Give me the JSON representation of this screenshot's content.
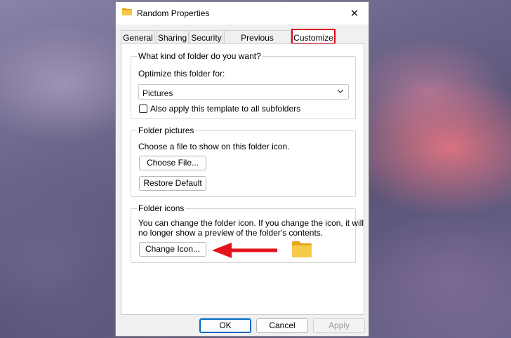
{
  "window": {
    "title": "Random Properties",
    "close_glyph": "✕"
  },
  "tabs": [
    {
      "label": "General"
    },
    {
      "label": "Sharing"
    },
    {
      "label": "Security"
    },
    {
      "label": "Previous Versions"
    },
    {
      "label": "Customize",
      "active": true
    }
  ],
  "folder_type": {
    "group_label": "What kind of folder do you want?",
    "optimize_label": "Optimize this folder for:",
    "selected": "Pictures",
    "apply_subfolders_label": "Also apply this template to all subfolders",
    "apply_subfolders_checked": false
  },
  "folder_pictures": {
    "group_label": "Folder pictures",
    "description": "Choose a file to show on this folder icon.",
    "choose_button": "Choose File...",
    "restore_button": "Restore Default"
  },
  "folder_icons": {
    "group_label": "Folder icons",
    "description_line1": "You can change the folder icon. If you change the icon, it will",
    "description_line2": "no longer show a preview of the folder's contents.",
    "change_button": "Change Icon..."
  },
  "footer": {
    "ok": "OK",
    "cancel": "Cancel",
    "apply": "Apply"
  },
  "colors": {
    "highlight": "#e0001b",
    "annotation_arrow": "#e3121b",
    "folder": "#f7c948"
  }
}
